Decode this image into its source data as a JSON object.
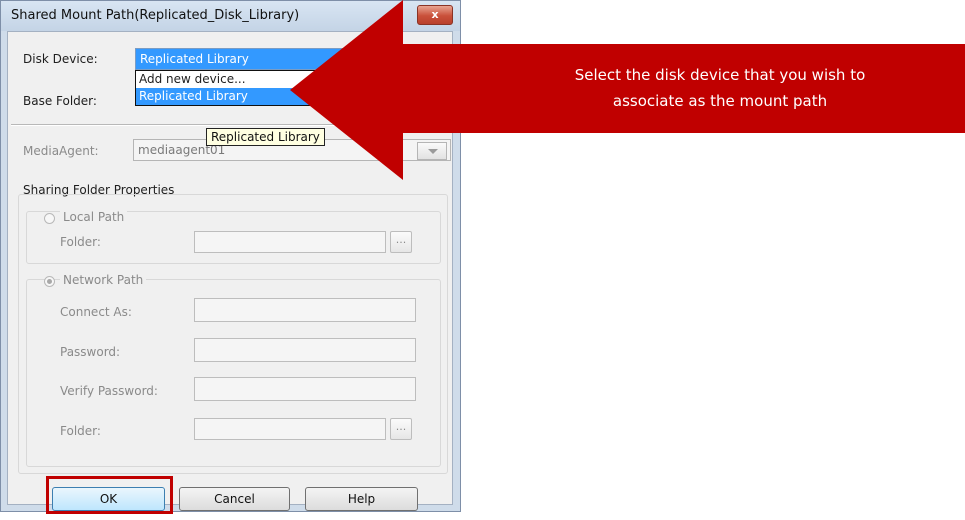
{
  "window": {
    "title": "Shared Mount Path(Replicated_Disk_Library)",
    "close_label": "x"
  },
  "disk_device": {
    "label": "Disk Device:",
    "selected": "Replicated Library",
    "options": [
      "Add new device...",
      "Replicated Library"
    ],
    "tooltip": "Replicated Library"
  },
  "base_folder": {
    "label": "Base Folder:"
  },
  "media_agent": {
    "label": "MediaAgent:",
    "value": "mediaagent01"
  },
  "sharing": {
    "title": "Sharing Folder Properties",
    "local_path": {
      "label": "Local Path",
      "folder_label": "Folder:",
      "browse": "..."
    },
    "network_path": {
      "label": "Network Path",
      "connect_as_label": "Connect As:",
      "password_label": "Password:",
      "verify_password_label": "Verify Password:",
      "folder_label": "Folder:",
      "browse": "..."
    }
  },
  "buttons": {
    "ok": "OK",
    "cancel": "Cancel",
    "help": "Help"
  },
  "callout": {
    "line1": "Select the disk device that you wish to",
    "line2": "associate as the mount path",
    "color": "#c00000"
  }
}
